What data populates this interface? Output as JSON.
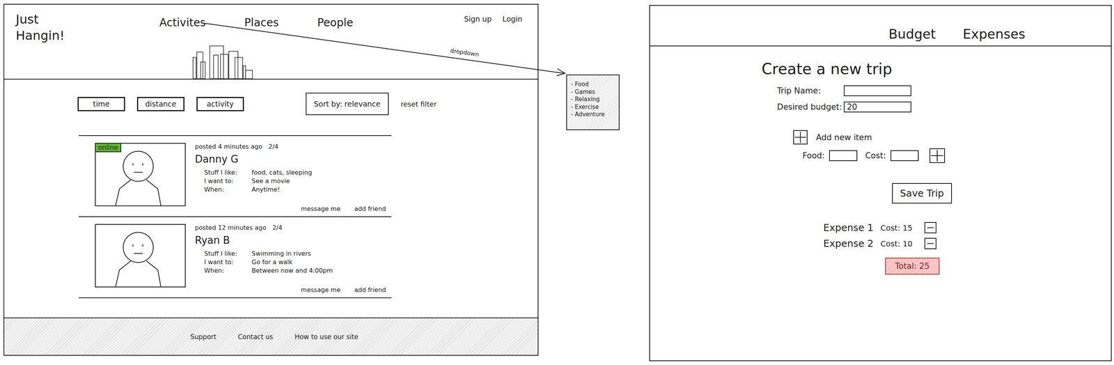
{
  "homepage": {
    "logo": [
      "Just",
      "Hangin!"
    ],
    "nav": [
      "Activites",
      "Places",
      "People"
    ],
    "auth": [
      "Sign up",
      "Login"
    ],
    "filters": [
      "time",
      "distance",
      "activity"
    ],
    "sort": "Sort by: relevance",
    "reset": "reset filter",
    "online_label": "online",
    "posts": [
      {
        "online": true,
        "posted": "posted 4 minutes ago",
        "count": "2/4",
        "name": "Danny G",
        "fields": [
          {
            "label": "Stuff I like:",
            "value": "food, cats, sleeping"
          },
          {
            "label": "I want to:",
            "value": "See a movie"
          },
          {
            "label": "When:",
            "value": "Anytime!"
          }
        ],
        "actions": [
          "message me",
          "add friend"
        ]
      },
      {
        "online": false,
        "posted": "posted 12 minutes ago",
        "count": "2/4",
        "name": "Ryan B",
        "fields": [
          {
            "label": "Stuff I like:",
            "value": "Swimming in rivers"
          },
          {
            "label": "I want to:",
            "value": "Go for a walk"
          },
          {
            "label": "When:",
            "value": "Between now and 4:00pm"
          }
        ],
        "actions": [
          "message me",
          "add friend"
        ]
      }
    ],
    "footer": [
      "Support",
      "Contact us",
      "How to use our site"
    ]
  },
  "annotation": {
    "label": "dropdown"
  },
  "dropdown": {
    "items": [
      "- Food",
      "- Games",
      "- Relaxing",
      "- Exercise",
      "- Adventure"
    ]
  },
  "trip_page": {
    "nav": [
      "Budget",
      "Expenses"
    ],
    "title": "Create a new trip",
    "fields": [
      {
        "label": "Trip Name:",
        "value": ""
      },
      {
        "label": "Desired budget:",
        "value": "20"
      }
    ],
    "add_item": "Add new item",
    "item_fields": [
      {
        "label": "Food:",
        "value": ""
      },
      {
        "label": "Cost:",
        "value": ""
      }
    ],
    "save": "Save Trip",
    "expenses": [
      {
        "name": "Expense 1",
        "cost": "Cost: 15"
      },
      {
        "name": "Expense 2",
        "cost": "Cost: 10"
      }
    ],
    "total": "Total: 25"
  }
}
